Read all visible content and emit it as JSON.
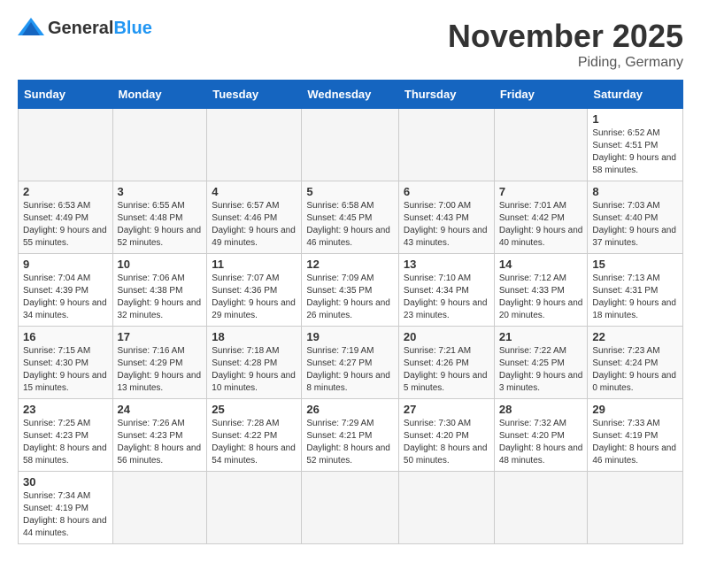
{
  "header": {
    "logo_general": "General",
    "logo_blue": "Blue",
    "month": "November 2025",
    "location": "Piding, Germany"
  },
  "weekdays": [
    "Sunday",
    "Monday",
    "Tuesday",
    "Wednesday",
    "Thursday",
    "Friday",
    "Saturday"
  ],
  "weeks": [
    [
      {
        "day": "",
        "info": ""
      },
      {
        "day": "",
        "info": ""
      },
      {
        "day": "",
        "info": ""
      },
      {
        "day": "",
        "info": ""
      },
      {
        "day": "",
        "info": ""
      },
      {
        "day": "",
        "info": ""
      },
      {
        "day": "1",
        "info": "Sunrise: 6:52 AM\nSunset: 4:51 PM\nDaylight: 9 hours and 58 minutes."
      }
    ],
    [
      {
        "day": "2",
        "info": "Sunrise: 6:53 AM\nSunset: 4:49 PM\nDaylight: 9 hours and 55 minutes."
      },
      {
        "day": "3",
        "info": "Sunrise: 6:55 AM\nSunset: 4:48 PM\nDaylight: 9 hours and 52 minutes."
      },
      {
        "day": "4",
        "info": "Sunrise: 6:57 AM\nSunset: 4:46 PM\nDaylight: 9 hours and 49 minutes."
      },
      {
        "day": "5",
        "info": "Sunrise: 6:58 AM\nSunset: 4:45 PM\nDaylight: 9 hours and 46 minutes."
      },
      {
        "day": "6",
        "info": "Sunrise: 7:00 AM\nSunset: 4:43 PM\nDaylight: 9 hours and 43 minutes."
      },
      {
        "day": "7",
        "info": "Sunrise: 7:01 AM\nSunset: 4:42 PM\nDaylight: 9 hours and 40 minutes."
      },
      {
        "day": "8",
        "info": "Sunrise: 7:03 AM\nSunset: 4:40 PM\nDaylight: 9 hours and 37 minutes."
      }
    ],
    [
      {
        "day": "9",
        "info": "Sunrise: 7:04 AM\nSunset: 4:39 PM\nDaylight: 9 hours and 34 minutes."
      },
      {
        "day": "10",
        "info": "Sunrise: 7:06 AM\nSunset: 4:38 PM\nDaylight: 9 hours and 32 minutes."
      },
      {
        "day": "11",
        "info": "Sunrise: 7:07 AM\nSunset: 4:36 PM\nDaylight: 9 hours and 29 minutes."
      },
      {
        "day": "12",
        "info": "Sunrise: 7:09 AM\nSunset: 4:35 PM\nDaylight: 9 hours and 26 minutes."
      },
      {
        "day": "13",
        "info": "Sunrise: 7:10 AM\nSunset: 4:34 PM\nDaylight: 9 hours and 23 minutes."
      },
      {
        "day": "14",
        "info": "Sunrise: 7:12 AM\nSunset: 4:33 PM\nDaylight: 9 hours and 20 minutes."
      },
      {
        "day": "15",
        "info": "Sunrise: 7:13 AM\nSunset: 4:31 PM\nDaylight: 9 hours and 18 minutes."
      }
    ],
    [
      {
        "day": "16",
        "info": "Sunrise: 7:15 AM\nSunset: 4:30 PM\nDaylight: 9 hours and 15 minutes."
      },
      {
        "day": "17",
        "info": "Sunrise: 7:16 AM\nSunset: 4:29 PM\nDaylight: 9 hours and 13 minutes."
      },
      {
        "day": "18",
        "info": "Sunrise: 7:18 AM\nSunset: 4:28 PM\nDaylight: 9 hours and 10 minutes."
      },
      {
        "day": "19",
        "info": "Sunrise: 7:19 AM\nSunset: 4:27 PM\nDaylight: 9 hours and 8 minutes."
      },
      {
        "day": "20",
        "info": "Sunrise: 7:21 AM\nSunset: 4:26 PM\nDaylight: 9 hours and 5 minutes."
      },
      {
        "day": "21",
        "info": "Sunrise: 7:22 AM\nSunset: 4:25 PM\nDaylight: 9 hours and 3 minutes."
      },
      {
        "day": "22",
        "info": "Sunrise: 7:23 AM\nSunset: 4:24 PM\nDaylight: 9 hours and 0 minutes."
      }
    ],
    [
      {
        "day": "23",
        "info": "Sunrise: 7:25 AM\nSunset: 4:23 PM\nDaylight: 8 hours and 58 minutes."
      },
      {
        "day": "24",
        "info": "Sunrise: 7:26 AM\nSunset: 4:23 PM\nDaylight: 8 hours and 56 minutes."
      },
      {
        "day": "25",
        "info": "Sunrise: 7:28 AM\nSunset: 4:22 PM\nDaylight: 8 hours and 54 minutes."
      },
      {
        "day": "26",
        "info": "Sunrise: 7:29 AM\nSunset: 4:21 PM\nDaylight: 8 hours and 52 minutes."
      },
      {
        "day": "27",
        "info": "Sunrise: 7:30 AM\nSunset: 4:20 PM\nDaylight: 8 hours and 50 minutes."
      },
      {
        "day": "28",
        "info": "Sunrise: 7:32 AM\nSunset: 4:20 PM\nDaylight: 8 hours and 48 minutes."
      },
      {
        "day": "29",
        "info": "Sunrise: 7:33 AM\nSunset: 4:19 PM\nDaylight: 8 hours and 46 minutes."
      }
    ],
    [
      {
        "day": "30",
        "info": "Sunrise: 7:34 AM\nSunset: 4:19 PM\nDaylight: 8 hours and 44 minutes."
      },
      {
        "day": "",
        "info": ""
      },
      {
        "day": "",
        "info": ""
      },
      {
        "day": "",
        "info": ""
      },
      {
        "day": "",
        "info": ""
      },
      {
        "day": "",
        "info": ""
      },
      {
        "day": "",
        "info": ""
      }
    ]
  ]
}
